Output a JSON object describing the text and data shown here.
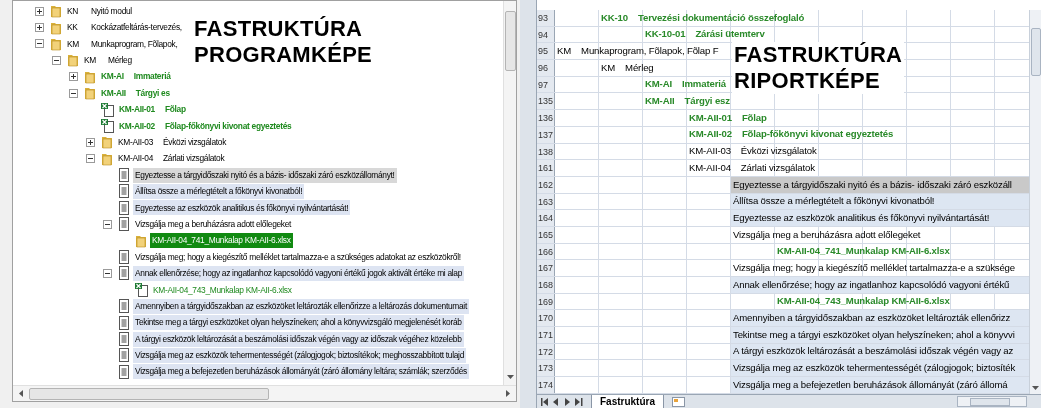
{
  "program_view": {
    "overlay_title": [
      "FASTRUKTÚRA",
      "PROGRAMKÉPE"
    ],
    "tree": [
      {
        "kind": "folder",
        "code": "KN",
        "label": "Nyitó modul",
        "emphasized": false,
        "highlighted": false,
        "focused": false,
        "selected": false,
        "expanded": false
      },
      {
        "kind": "folder",
        "code": "KK",
        "label": "Kockázatfeltárás-tervezés,",
        "emphasized": false,
        "highlighted": false,
        "focused": false,
        "selected": false,
        "expanded": false
      },
      {
        "kind": "folder",
        "code": "KM",
        "label": "Munkaprogram, Fõlapok,",
        "emphasized": false,
        "highlighted": false,
        "focused": false,
        "selected": false,
        "expanded": true,
        "children": [
          {
            "kind": "folder",
            "code": "KM",
            "label": "Mérleg",
            "emphasized": false,
            "highlighted": false,
            "focused": false,
            "selected": false,
            "expanded": true,
            "children": [
              {
                "kind": "folder",
                "code": "KM-AI",
                "label": "Immateriá",
                "emphasized": true,
                "highlighted": false,
                "focused": false,
                "selected": false,
                "expanded": false
              },
              {
                "kind": "folder",
                "code": "KM-AII",
                "label": "Tárgyi es",
                "emphasized": true,
                "highlighted": false,
                "focused": false,
                "selected": false,
                "expanded": true,
                "children": [
                  {
                    "kind": "excel",
                    "code": "KM-AII-01",
                    "label": "Fõlap",
                    "emphasized": true,
                    "highlighted": false,
                    "focused": false,
                    "selected": false
                  },
                  {
                    "kind": "excel",
                    "code": "KM-AII-02",
                    "label": "Fõlap-főkönyvi kivonat egyeztetés",
                    "emphasized": true,
                    "highlighted": false,
                    "focused": false,
                    "selected": false
                  },
                  {
                    "kind": "folder",
                    "code": "KM-AII-03",
                    "label": "Évközi vizsgálatok",
                    "emphasized": false,
                    "highlighted": false,
                    "focused": false,
                    "selected": false,
                    "expanded": false
                  },
                  {
                    "kind": "folder",
                    "code": "KM-AII-04",
                    "label": "Zárlati vizsgálatok",
                    "emphasized": false,
                    "highlighted": false,
                    "focused": false,
                    "selected": false,
                    "expanded": true,
                    "children": [
                      {
                        "kind": "document",
                        "label": "Egyeztesse a tárgyidőszaki nyitó és a bázis- időszaki záró eszközállományt!",
                        "emphasized": false,
                        "focused": true,
                        "selected": false
                      },
                      {
                        "kind": "document",
                        "label": "Állítsa össze a mérlegtételt a főkönyvi kivonatból!",
                        "emphasized": false,
                        "highlighted": true,
                        "focused": false,
                        "selected": false
                      },
                      {
                        "kind": "document",
                        "label": "Egyeztesse az eszközök analitikus és főkönyvi nyilvántartását!",
                        "emphasized": false,
                        "highlighted": true,
                        "focused": false,
                        "selected": false
                      },
                      {
                        "kind": "document",
                        "label": "Vizsgálja meg a beruházásra adott előlegeket",
                        "emphasized": false,
                        "highlighted": false,
                        "focused": false,
                        "selected": false,
                        "expanded": true,
                        "children": [
                          {
                            "kind": "folder",
                            "label": "KM-AII-04_741_Munkalap KM-AII-6.xlsx",
                            "selected": true
                          }
                        ]
                      },
                      {
                        "kind": "document",
                        "label": "Vizsgálja meg; hogy a kiegészítő melléklet tartalmazza-e a szükséges adatokat az eszközökről!",
                        "emphasized": false,
                        "highlighted": false,
                        "focused": false,
                        "selected": false
                      },
                      {
                        "kind": "document",
                        "label": "Annak ellenőrzése; hogy az ingatlanhoz kapcsolódó vagyoni értékű jogok aktivált értéke mi alap",
                        "emphasized": false,
                        "highlighted": true,
                        "focused": false,
                        "selected": false,
                        "expanded": true,
                        "children": [
                          {
                            "kind": "excel",
                            "label": "KM-AII-04_743_Munkalap KM-AII-6.xlsx",
                            "emphasized": true,
                            "highlighted": false,
                            "focused": false,
                            "selected": false
                          }
                        ]
                      },
                      {
                        "kind": "document",
                        "label": "Amennyiben a tárgyidőszakban az eszközöket leltározták ellenőrizze a leltározás dokumentumait",
                        "emphasized": false,
                        "highlighted": true,
                        "focused": false,
                        "selected": false
                      },
                      {
                        "kind": "document",
                        "label": "Tekintse meg a tárgyi eszközöket olyan helyszíneken; ahol a könyvvizsgáló megjelenését koráb",
                        "emphasized": false,
                        "highlighted": true,
                        "focused": false,
                        "selected": false
                      },
                      {
                        "kind": "document",
                        "label": "A tárgyi eszközök leltározását a beszámolási időszak végén vagy az időszak végéhez közelebb",
                        "emphasized": false,
                        "highlighted": true,
                        "focused": false,
                        "selected": false
                      },
                      {
                        "kind": "document",
                        "label": "Vizsgálja meg az eszközök tehermentességét (zálogjogok; biztosítékok; meghosszabbított tulajd",
                        "emphasized": false,
                        "highlighted": true,
                        "focused": false,
                        "selected": false
                      },
                      {
                        "kind": "document",
                        "label": "Vizsgálja meg a befejezetlen beruházások állományát (záró állomány leltára; számlák; szerződés",
                        "emphasized": false,
                        "highlighted": true,
                        "focused": false,
                        "selected": false
                      }
                    ]
                  }
                ]
              }
            ]
          }
        ]
      }
    ]
  },
  "report_view": {
    "overlay_title": [
      "FASTRUKTÚRA",
      "RIPORTKÉPE"
    ],
    "rows": [
      {
        "number": "93",
        "kind": "area",
        "code": "KK-10",
        "text": "Tervezési dokumentáció összefoglaló",
        "emphasized": true,
        "highlighted": false,
        "focused": false
      },
      {
        "number": "94",
        "kind": "section",
        "code": "KK-10-01",
        "text": "Zárási ütemterv",
        "emphasized": true,
        "highlighted": false,
        "focused": false
      },
      {
        "number": "95",
        "kind": "module",
        "code": "KM",
        "text": "Munkaprogram, Fõlapok, Fõlap F",
        "emphasized": false,
        "highlighted": false,
        "focused": false
      },
      {
        "number": "96",
        "kind": "area",
        "code": "KM",
        "text": "Mérleg",
        "emphasized": false,
        "highlighted": false,
        "focused": false
      },
      {
        "number": "97",
        "kind": "section",
        "code": "KM-AI",
        "text": "Immateriá",
        "emphasized": true,
        "highlighted": false,
        "focused": false
      },
      {
        "number": "135",
        "kind": "section",
        "code": "KM-AII",
        "text": "Tárgyi esz",
        "emphasized": true,
        "highlighted": false,
        "focused": false
      },
      {
        "number": "136",
        "kind": "test",
        "code": "KM-AII-01",
        "text": "Fõlap",
        "emphasized": true,
        "highlighted": false,
        "focused": false
      },
      {
        "number": "137",
        "kind": "test",
        "code": "KM-AII-02",
        "text": "Fõlap-főkönyvi kivonat egyeztetés",
        "emphasized": true,
        "highlighted": false,
        "focused": false
      },
      {
        "number": "138",
        "kind": "test",
        "code": "KM-AII-03",
        "text": "Évközi vizsgálatok",
        "emphasized": false,
        "highlighted": false,
        "focused": false
      },
      {
        "number": "161",
        "kind": "test",
        "code": "KM-AII-04",
        "text": "Zárlati vizsgálatok",
        "emphasized": false,
        "highlighted": false,
        "focused": false
      },
      {
        "number": "162",
        "kind": "step",
        "text": "Egyeztesse a tárgyidőszaki nyitó és a bázis- időszaki záró eszközáll",
        "emphasized": false,
        "focused": true
      },
      {
        "number": "163",
        "kind": "step",
        "text": "Állítsa össze a mérlegtételt a főkönyvi kivonatból!",
        "emphasized": false,
        "highlighted": true,
        "focused": false
      },
      {
        "number": "164",
        "kind": "step",
        "text": "Egyeztesse az eszközök analitikus és főkönyvi nyilvántartását!",
        "emphasized": false,
        "highlighted": true,
        "focused": false
      },
      {
        "number": "165",
        "kind": "step",
        "text": "Vizsgálja meg a beruházásra adott előlegeket",
        "emphasized": false,
        "highlighted": false,
        "focused": false
      },
      {
        "number": "166",
        "kind": "file",
        "text": "KM-AII-04_741_Munkalap KM-AII-6.xlsx",
        "emphasized": true,
        "highlighted": false,
        "focused": false
      },
      {
        "number": "167",
        "kind": "step",
        "text": "Vizsgálja meg; hogy a kiegészítő melléklet tartalmazza-e a szüksége",
        "emphasized": false,
        "highlighted": false,
        "focused": false
      },
      {
        "number": "168",
        "kind": "step",
        "text": "Annak ellenőrzése; hogy az ingatlanhoz kapcsolódó vagyoni értékű",
        "emphasized": false,
        "highlighted": true,
        "focused": false
      },
      {
        "number": "169",
        "kind": "file",
        "text": "KM-AII-04_743_Munkalap KM-AII-6.xlsx",
        "emphasized": true,
        "highlighted": false,
        "focused": false
      },
      {
        "number": "170",
        "kind": "step",
        "text": "Amennyiben a tárgyidőszakban az eszközöket leltározták ellenőrizz",
        "emphasized": false,
        "highlighted": true,
        "focused": false
      },
      {
        "number": "171",
        "kind": "step",
        "text": "Tekintse meg a tárgyi eszközöket olyan helyszíneken; ahol a könyvvi",
        "emphasized": false,
        "highlighted": true,
        "focused": false
      },
      {
        "number": "172",
        "kind": "step",
        "text": "A tárgyi eszközök leltározását a beszámolási időszak végén vagy az",
        "emphasized": false,
        "highlighted": true,
        "focused": false
      },
      {
        "number": "173",
        "kind": "step",
        "text": "Vizsgálja meg az eszközök tehermentességét (zálogjogok; biztosíték",
        "emphasized": false,
        "highlighted": true,
        "focused": false
      },
      {
        "number": "174",
        "kind": "step",
        "text": "Vizsgálja meg a befejezetlen beruházások állományát (záró állomá",
        "emphasized": false,
        "highlighted": true,
        "focused": false
      }
    ],
    "sheet_tabs": [
      {
        "label": "Fastruktúra",
        "selected": true
      }
    ]
  }
}
